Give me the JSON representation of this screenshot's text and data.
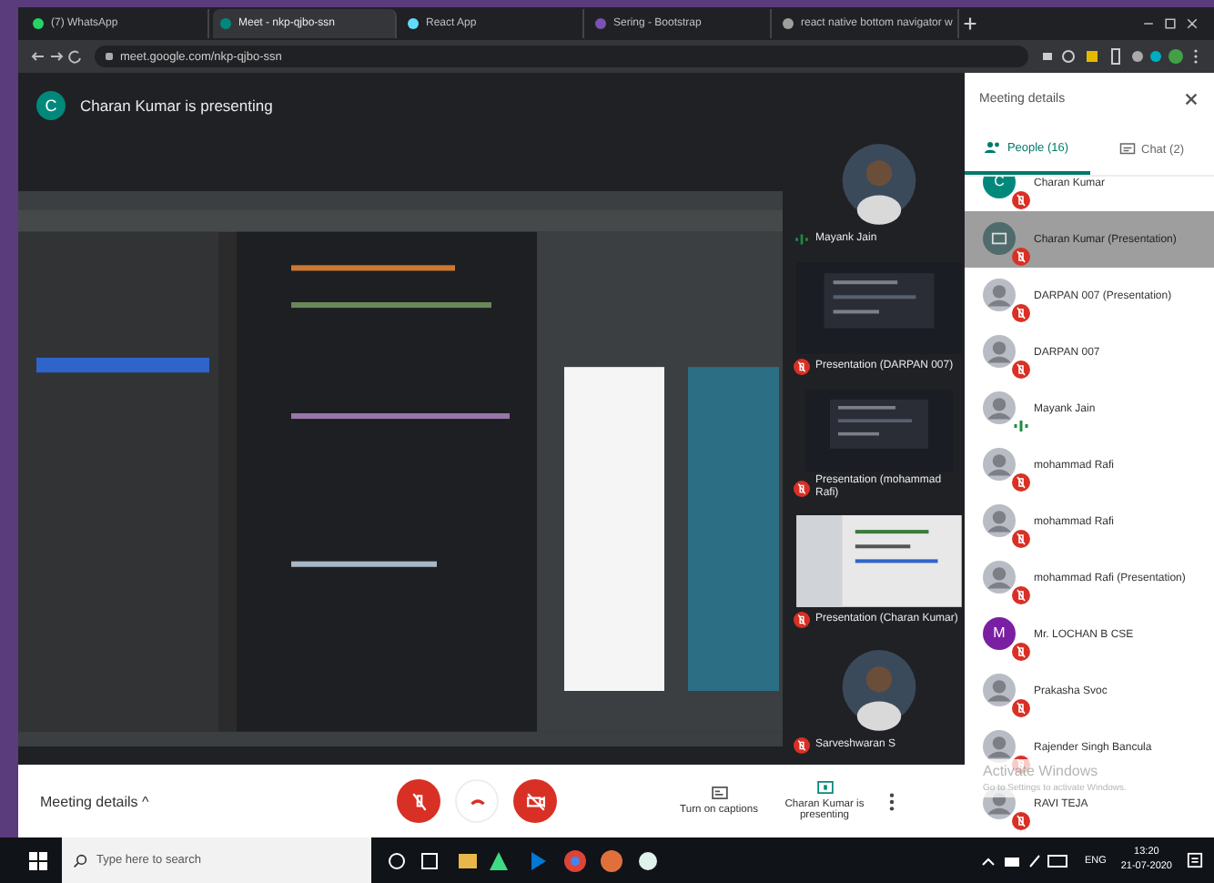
{
  "browser": {
    "tabs": [
      {
        "title": "(7) WhatsApp",
        "selected": false,
        "color": "#25d366"
      },
      {
        "title": "Meet - nkp-qjbo-ssn",
        "selected": true,
        "color": "#00897b"
      },
      {
        "title": "React App",
        "selected": false,
        "color": "#61dafb"
      },
      {
        "title": "Sering - Bootstrap",
        "selected": false,
        "color": "#7952b3"
      },
      {
        "title": "react native bottom navigator w",
        "selected": false,
        "color": "#9e9e9e"
      }
    ],
    "address": "meet.google.com/nkp-qjbo-ssn"
  },
  "meeting": {
    "presenter_initial": "C",
    "banner": "Charan Kumar is presenting"
  },
  "tiles": [
    {
      "name": "Mayank Jain",
      "muted": false,
      "kind": "avatar"
    },
    {
      "name": "Presentation (DARPAN 007)",
      "muted": true,
      "kind": "screen"
    },
    {
      "name": "Presentation (mohammad Rafi)",
      "muted": true,
      "kind": "screen"
    },
    {
      "name": "Presentation (Charan Kumar)",
      "muted": true,
      "kind": "light-screen"
    },
    {
      "name": "Sarveshwaran S",
      "muted": true,
      "kind": "avatar"
    }
  ],
  "controls": {
    "details": "Meeting details",
    "details_caret": "^",
    "mic_on": false,
    "camera_on": false,
    "captions": "Turn on captions",
    "presenting": "Charan Kumar is presenting"
  },
  "panel": {
    "title": "Meeting details",
    "tabs": [
      {
        "label": "People (16)",
        "selected": true
      },
      {
        "label": "Chat (2)",
        "selected": false
      }
    ],
    "people": [
      {
        "name": "Charan Kumar",
        "muted": true,
        "selected": false,
        "kind": "letter",
        "initial": "C",
        "color": "#00897b"
      },
      {
        "name": "Charan Kumar (Presentation)",
        "muted": true,
        "selected": true,
        "kind": "screen"
      },
      {
        "name": "DARPAN 007 (Presentation)",
        "muted": true,
        "selected": false
      },
      {
        "name": "DARPAN 007",
        "muted": true,
        "selected": false
      },
      {
        "name": "Mayank Jain",
        "muted": false,
        "selected": false
      },
      {
        "name": "mohammad Rafi",
        "muted": true,
        "selected": false
      },
      {
        "name": "mohammad Rafi",
        "muted": true,
        "selected": false
      },
      {
        "name": "mohammad Rafi (Presentation)",
        "muted": true,
        "selected": false
      },
      {
        "name": "Mr. LOCHAN B CSE",
        "muted": true,
        "selected": false,
        "kind": "letter",
        "initial": "M",
        "color": "#7b1fa2"
      },
      {
        "name": "Prakasha Svoc",
        "muted": true,
        "selected": false
      },
      {
        "name": "Rajender Singh Bancula",
        "muted": true,
        "selected": false
      },
      {
        "name": "RAVI TEJA",
        "muted": true,
        "selected": false
      }
    ]
  },
  "activation": {
    "title": "Activate Windows",
    "text": "Go to Settings to activate Windows."
  },
  "taskbar": {
    "search_placeholder": "Type here to search",
    "language": "ENG",
    "time": "13:20",
    "date": "21-07-2020"
  }
}
